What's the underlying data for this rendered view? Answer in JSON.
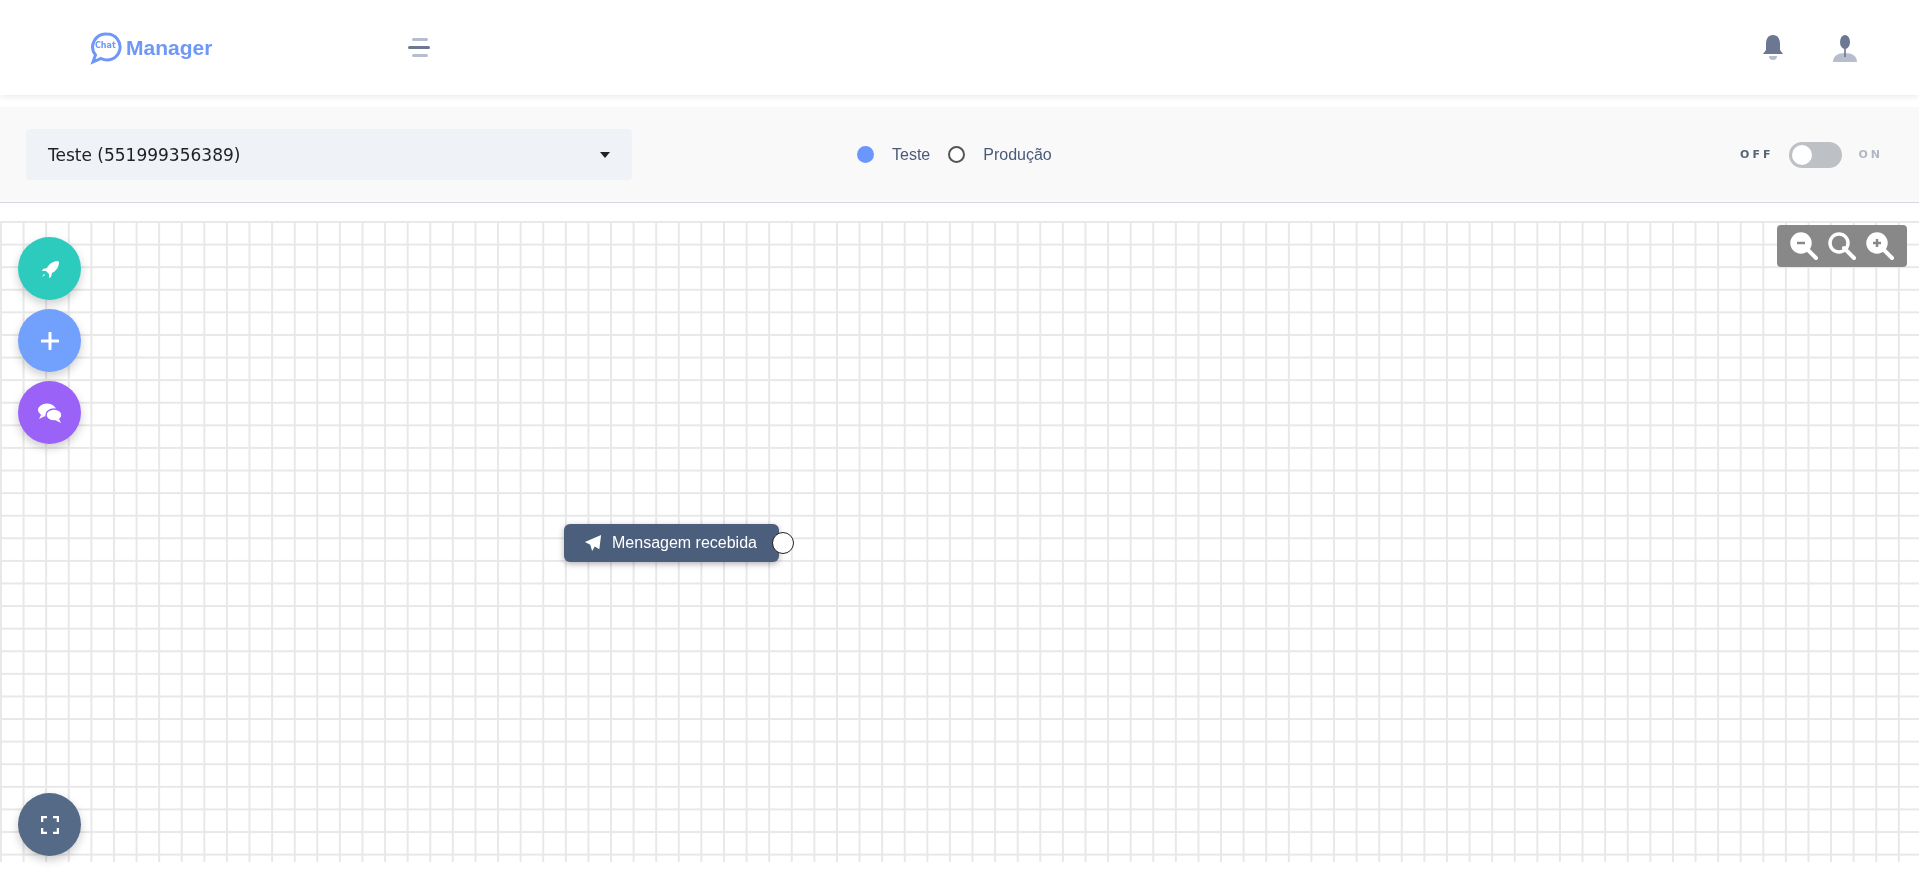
{
  "header": {
    "logo_badge": "Chat",
    "logo_text": "Manager"
  },
  "toolbar": {
    "number_select": {
      "value": "Teste (551999356389)"
    },
    "environments": [
      {
        "label": "Teste",
        "selected": true
      },
      {
        "label": "Produção",
        "selected": false
      }
    ],
    "switch": {
      "off_label": "OFF",
      "on_label": "ON",
      "on": false
    }
  },
  "canvas": {
    "nodes": [
      {
        "label": "Mensagem recebida"
      }
    ]
  }
}
